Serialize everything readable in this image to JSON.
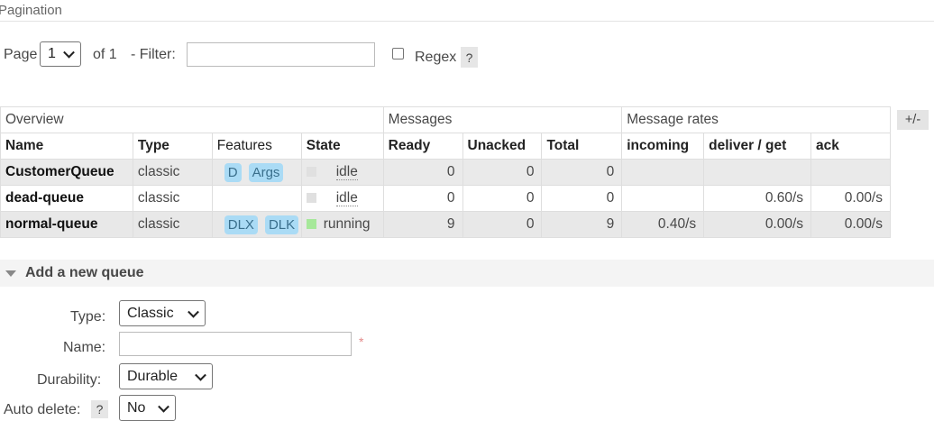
{
  "pagination": {
    "title": "Pagination",
    "page_label": "Page",
    "page_value": "1",
    "of_label": "of 1",
    "filter_label": "- Filter:",
    "filter_value": "",
    "regex_label": "Regex",
    "regex_checked": false,
    "help_glyph": "?"
  },
  "table": {
    "groups": [
      "Overview",
      "Messages",
      "Message rates"
    ],
    "columns": [
      "Name",
      "Type",
      "Features",
      "State",
      "Ready",
      "Unacked",
      "Total",
      "incoming",
      "deliver / get",
      "ack"
    ],
    "toggle_label": "+/-",
    "rows": [
      {
        "name": "CustomerQueue",
        "type": "classic",
        "features": [
          "D",
          "Args"
        ],
        "state": "idle",
        "state_color": "#e0e0e0",
        "ready": "0",
        "unacked": "0",
        "total": "0",
        "incoming": "",
        "deliver_get": "",
        "ack": ""
      },
      {
        "name": "dead-queue",
        "type": "classic",
        "features": [],
        "state": "idle",
        "state_color": "#e0e0e0",
        "ready": "0",
        "unacked": "0",
        "total": "0",
        "incoming": "",
        "deliver_get": "0.60/s",
        "ack": "0.00/s"
      },
      {
        "name": "normal-queue",
        "type": "classic",
        "features": [
          "DLX",
          "DLK"
        ],
        "state": "running",
        "state_color": "#a6e89a",
        "ready": "9",
        "unacked": "0",
        "total": "9",
        "incoming": "0.40/s",
        "deliver_get": "0.00/s",
        "ack": "0.00/s"
      }
    ]
  },
  "add_queue": {
    "title": "Add a new queue",
    "collapse_icon": "triangle-down-icon",
    "type_label": "Type:",
    "type_value": "Classic",
    "name_label": "Name:",
    "name_value": "",
    "required_mark": "*",
    "durability_label": "Durability:",
    "durability_value": "Durable",
    "auto_delete_label": "Auto delete:",
    "auto_delete_help": "?",
    "auto_delete_value": "No"
  }
}
